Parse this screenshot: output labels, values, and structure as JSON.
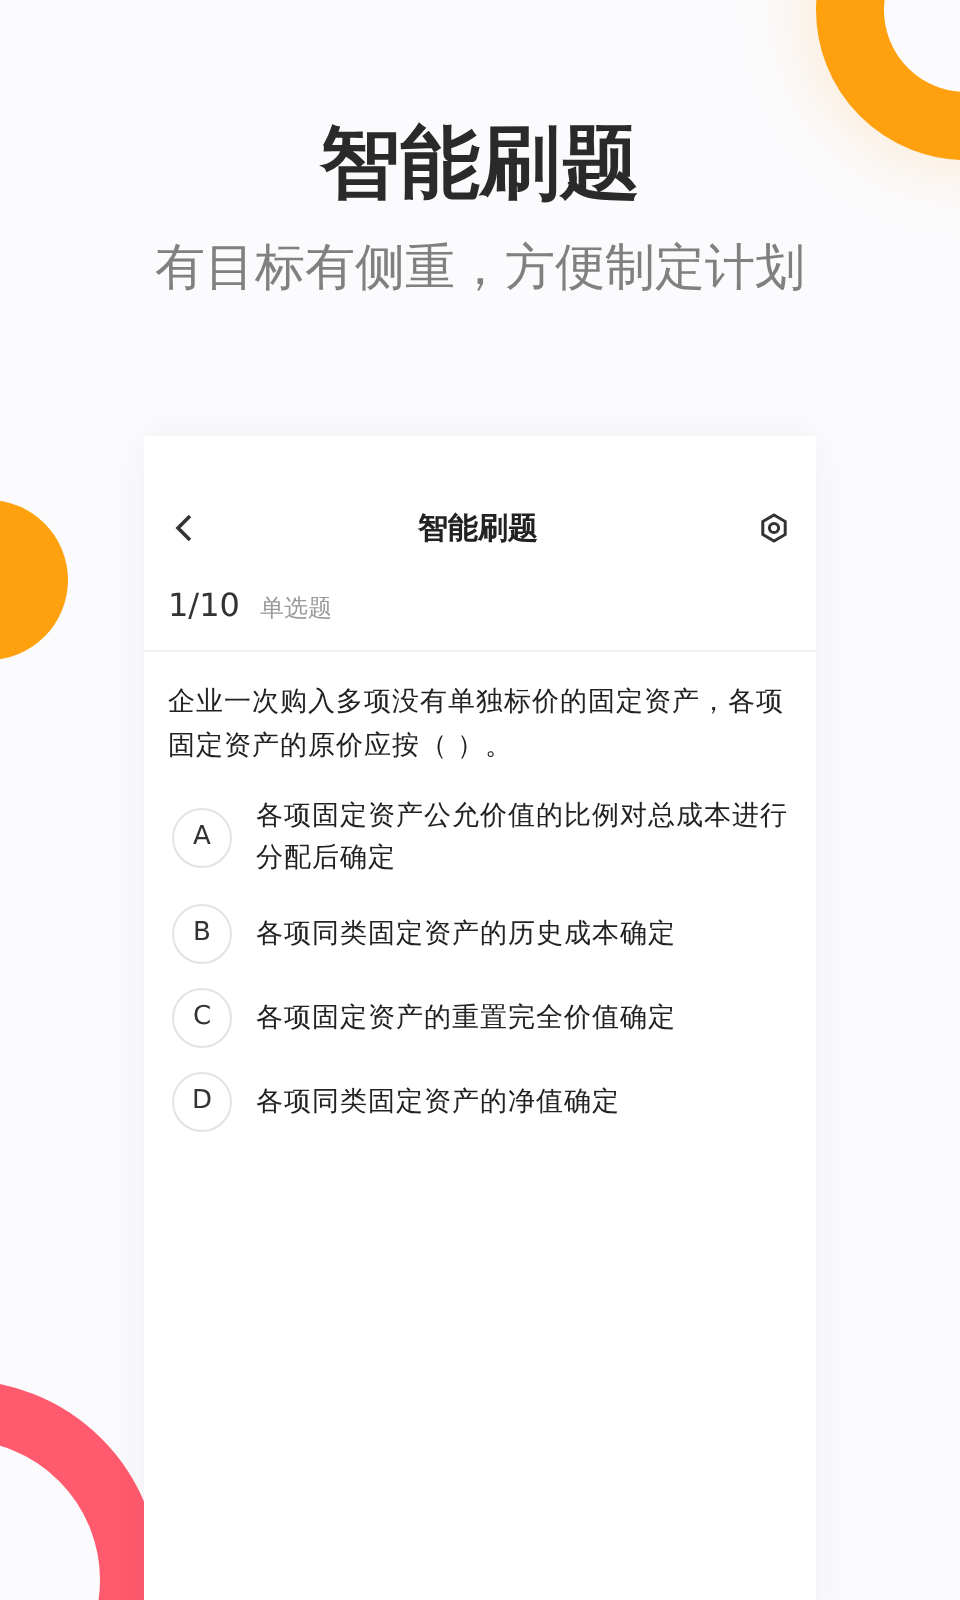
{
  "headline": "智能刷题",
  "subtitle": "有目标有侧重，方便制定计划",
  "screen": {
    "title": "智能刷题",
    "progress": "1/10",
    "question_type": "单选题",
    "question": "企业一次购入多项没有单独标价的固定资产，各项固定资产的原价应按（ ）。",
    "options": [
      {
        "letter": "A",
        "text": "各项固定资产公允价值的比例对总成本进行分配后确定"
      },
      {
        "letter": "B",
        "text": "各项同类固定资产的历史成本确定"
      },
      {
        "letter": "C",
        "text": "各项固定资产的重置完全价值确定"
      },
      {
        "letter": "D",
        "text": "各项同类固定资产的净值确定"
      }
    ]
  }
}
